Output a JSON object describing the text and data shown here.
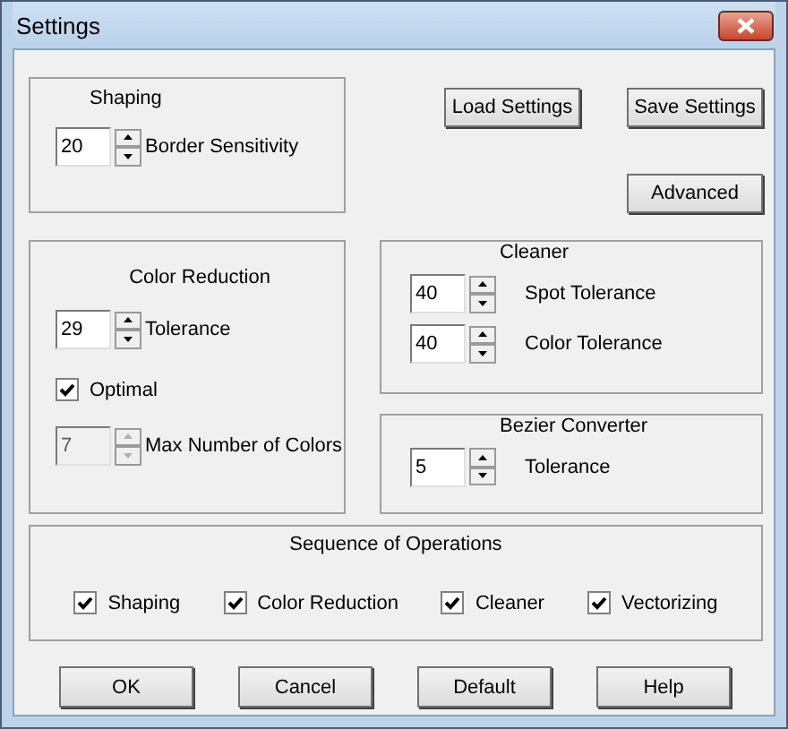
{
  "window": {
    "title": "Settings"
  },
  "shaping": {
    "title": "Shaping",
    "controls": [
      {
        "kind": "spinner",
        "value": "20",
        "label": "Border Sensitivity",
        "disabled": false
      }
    ]
  },
  "top_buttons": [
    "Load Settings",
    "Save Settings",
    "Advanced"
  ],
  "color_reduction": {
    "title": "Color Reduction",
    "controls": [
      {
        "kind": "spinner",
        "value": "29",
        "label": "Tolerance",
        "disabled": false
      },
      {
        "kind": "checkbox",
        "label": "Optimal",
        "checked": true
      },
      {
        "kind": "spinner",
        "value": "7",
        "label": "Max Number of Colors",
        "disabled": true
      }
    ]
  },
  "cleaner": {
    "title": "Cleaner",
    "controls": [
      {
        "kind": "spinner",
        "value": "40",
        "label": "Spot Tolerance",
        "disabled": false
      },
      {
        "kind": "spinner",
        "value": "40",
        "label": "Color Tolerance",
        "disabled": false
      }
    ]
  },
  "bezier_converter": {
    "title": "Bezier Converter",
    "controls": [
      {
        "kind": "spinner",
        "value": "5",
        "label": "Tolerance",
        "disabled": false
      }
    ]
  },
  "sequence": {
    "title": "Sequence of Operations",
    "items": [
      {
        "label": "Shaping",
        "checked": true
      },
      {
        "label": "Color Reduction",
        "checked": true
      },
      {
        "label": "Cleaner",
        "checked": true
      },
      {
        "label": "Vectorizing",
        "checked": true
      }
    ]
  },
  "buttons": [
    "OK",
    "Cancel",
    "Default",
    "Help"
  ]
}
